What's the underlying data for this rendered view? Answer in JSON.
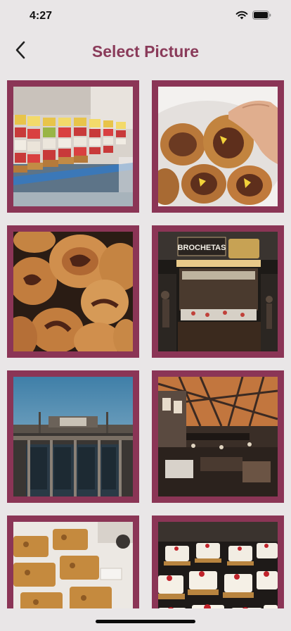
{
  "status_bar": {
    "time": "4:27",
    "icons": [
      "wifi-icon",
      "battery-icon"
    ]
  },
  "nav": {
    "title": "Select Picture",
    "back_icon": "chevron-left-icon"
  },
  "colors": {
    "accent": "#8a3b5a",
    "tile_frame": "#8b3556",
    "background": "#e9e6e7"
  },
  "photos": [
    {
      "id": "photo-skewers"
    },
    {
      "id": "photo-pastries-hand"
    },
    {
      "id": "photo-pastries-closeup"
    },
    {
      "id": "photo-brochetas-stall",
      "sign": "BROCHETAS"
    },
    {
      "id": "photo-market-facade"
    },
    {
      "id": "photo-market-interior"
    },
    {
      "id": "photo-nut-bars"
    },
    {
      "id": "photo-cheese-tarts"
    }
  ]
}
